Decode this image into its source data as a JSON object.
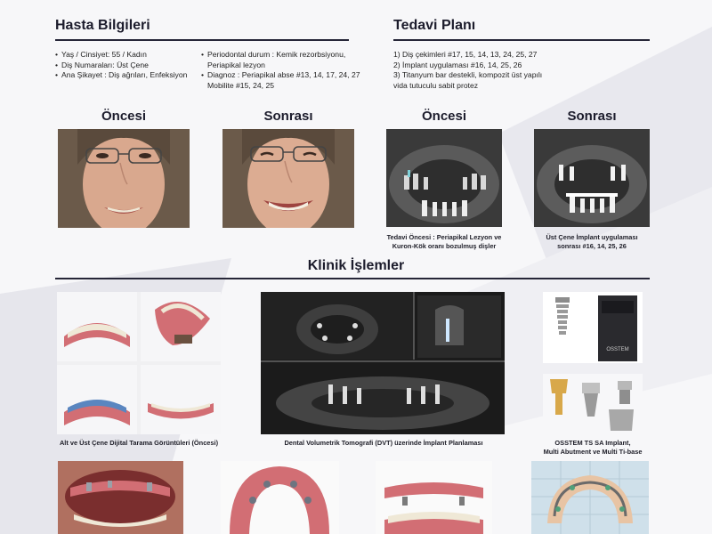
{
  "patient_info": {
    "title": "Hasta Bilgileri",
    "col1": [
      "Yaş / Cinsiyet: 55 / Kadın",
      "Diş Numaraları:  Üst Çene",
      "Ana Şikayet : Diş ağrıları, Enfeksiyon"
    ],
    "col2": [
      "Periodontal durum  : Kemik rezorbsiyonu,",
      "Periapikal lezyon",
      "Diagnoz  : Periapikal abse #13, 14, 17, 24, 27",
      "Mobilite #15, 24, 25"
    ]
  },
  "treatment_plan": {
    "title": "Tedavi Planı",
    "items": [
      "1) Diş çekimleri #17, 15, 14, 13, 24, 25, 27",
      "2) İmplant uygulaması  #16, 14, 25, 26",
      "3) Titanyum bar destekli, kompozit üst yapılı",
      "vida tutuculu sabit protez"
    ]
  },
  "photos": {
    "before_label": "Öncesi",
    "after_label": "Sonrası",
    "xray_before_label": "Öncesi",
    "xray_after_label": "Sonrası",
    "xray_before_caption_1": "Tedavi Öncesi : Periapikal Lezyon ve",
    "xray_before_caption_2": "Kuron-Kök oranı bozulmuş dişler",
    "xray_after_caption_1": "Üst Çene İmplant uygulaması",
    "xray_after_caption_2": "sonrası #16, 14, 25, 26"
  },
  "clinical": {
    "title": "Klinik İşlemler",
    "scan_caption": "Alt ve Üst Çene Dijital Tarama Görüntüleri (Öncesi)",
    "dvt_caption": "Dental Volumetrik Tomografi (DVT) üzerinde İmplant Planlaması",
    "implant_caption_1": "OSSTEM TS SA Implant,",
    "implant_caption_2": "Multi Abutment ve Multi Ti-base",
    "box_brand": "OSSTEM"
  },
  "colors": {
    "title": "#1c1c2c",
    "rule": "#262638",
    "skin": "#d9a88e",
    "hijab": "#6b5a4a",
    "xray_bg": "#3a3a3a",
    "gum": "#d26e74",
    "teeth": "#efe8d6",
    "model": "#e8c4a4"
  }
}
